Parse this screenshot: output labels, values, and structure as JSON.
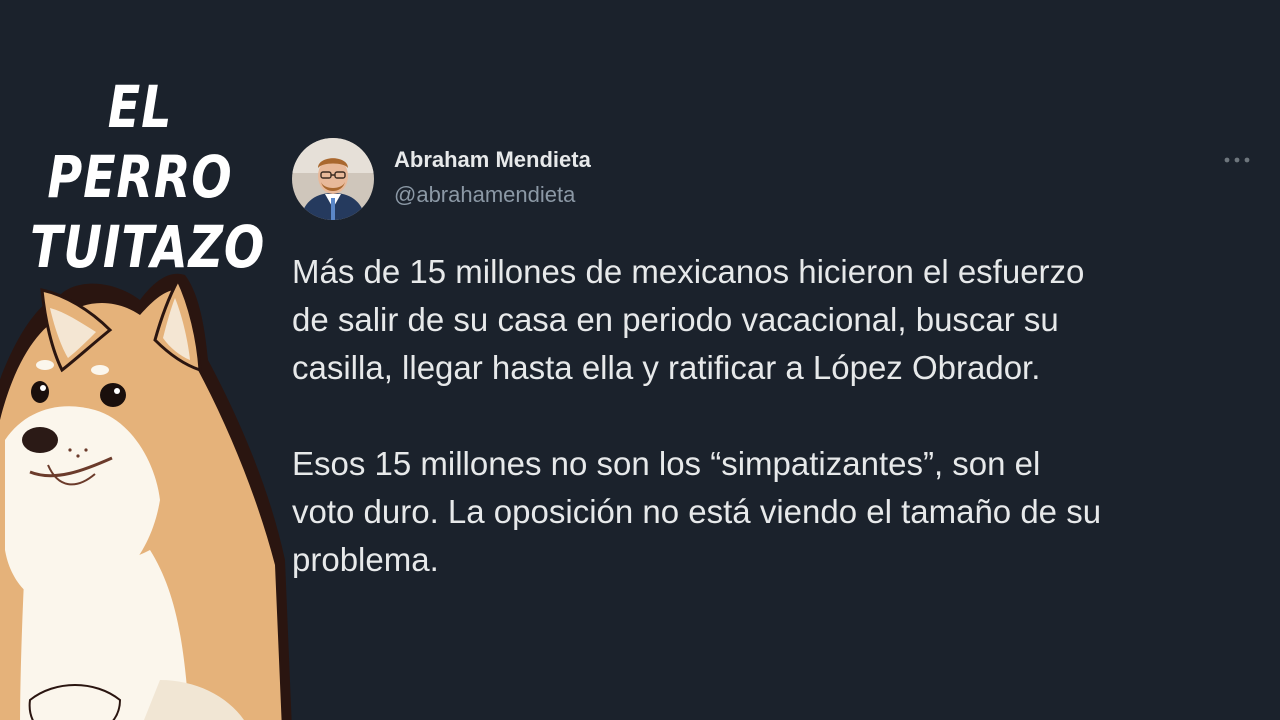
{
  "brand": {
    "line1": "EL PERRO",
    "line2": "TUITAZO"
  },
  "tweet": {
    "author_name": "Abraham Mendieta",
    "author_handle": "@abrahamendieta",
    "paragraph1": "Más de 15 millones de mexicanos hicieron el esfuerzo\nde salir de su casa en periodo vacacional, buscar su\ncasilla, llegar hasta ella y ratificar a López Obrador.",
    "paragraph2": "Esos 15 millones no son los “simpatizantes”, son el\nvoto duro. La oposición no está viendo el tamaño de su\nproblema.",
    "more_icon": "more-horizontal-icon"
  },
  "colors": {
    "background": "#1b222c",
    "text": "#e7e9ea",
    "muted": "#8b98a5"
  }
}
